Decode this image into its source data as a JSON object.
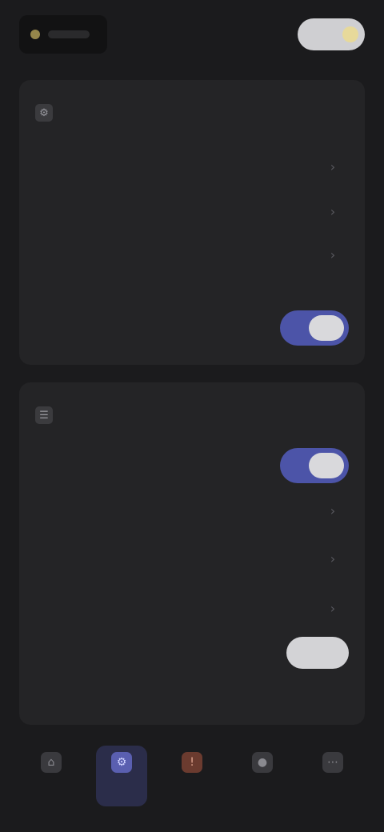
{
  "header": {
    "app_title": "",
    "logo_icon": "logo-mark",
    "profile_icon": "profile-pill"
  },
  "colors": {
    "background": "#1b1b1d",
    "card": "#242426",
    "accent": "#4c54a8",
    "link": "#5f6aa8"
  },
  "section_1": {
    "title": "",
    "icon": "settings-icon",
    "rows": [
      {
        "label": "",
        "value": ""
      },
      {
        "label": "",
        "value": ""
      },
      {
        "label": ""
      },
      {
        "label": "",
        "toggle": true
      }
    ]
  },
  "section_2": {
    "title": "",
    "icon": "preferences-icon",
    "rows": [
      {
        "label": "",
        "toggle": true
      },
      {
        "label": ""
      },
      {
        "label": ""
      },
      {
        "label": ""
      },
      {
        "label": "",
        "toggle": false
      },
      {
        "label": "",
        "link": ""
      }
    ]
  },
  "bottom_nav": {
    "items": [
      {
        "label": "",
        "icon": "home-icon",
        "active": false
      },
      {
        "label": "",
        "icon": "settings-icon",
        "active": true
      },
      {
        "label": "",
        "icon": "alert-icon",
        "active": false
      },
      {
        "label": "",
        "icon": "user-icon",
        "active": false
      },
      {
        "label": "",
        "icon": "more-icon",
        "active": false
      }
    ]
  }
}
